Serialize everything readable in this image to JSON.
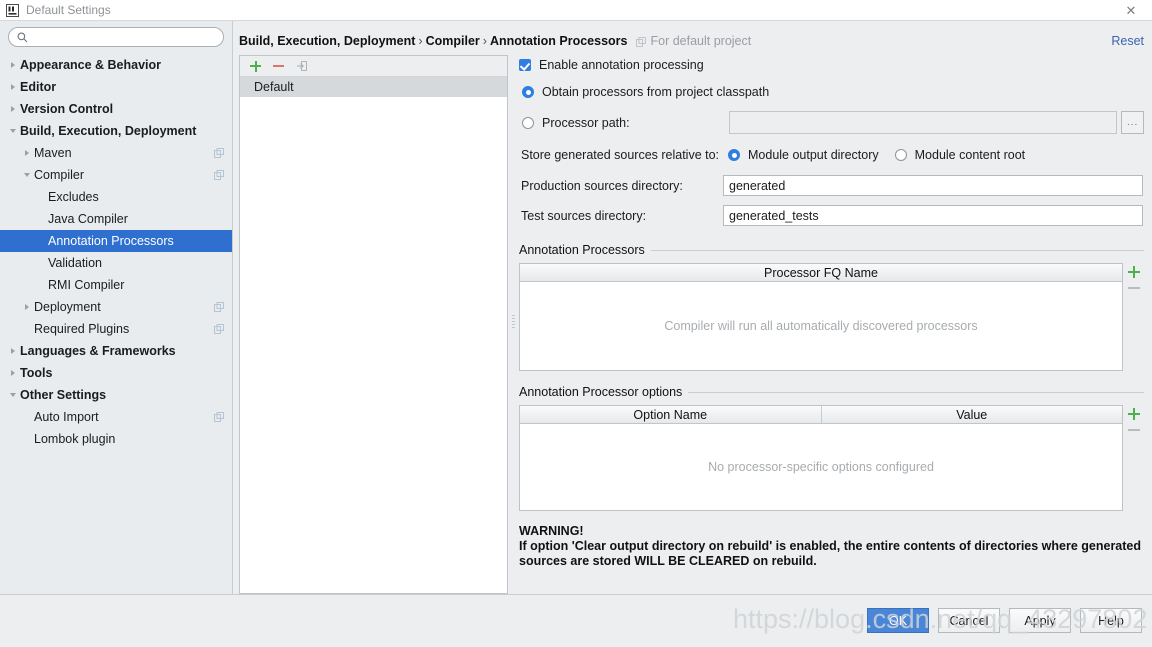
{
  "window": {
    "title": "Default Settings",
    "app_icon": "intellij-idea-icon",
    "close_label": "✕"
  },
  "sidebar": {
    "search": {
      "value": "",
      "placeholder": "",
      "icon": "search-icon"
    },
    "items": [
      {
        "label": "Appearance & Behavior",
        "indent": 0,
        "twisty": "right",
        "bold": true,
        "badge": false,
        "selected": false
      },
      {
        "label": "Editor",
        "indent": 0,
        "twisty": "right",
        "bold": true,
        "badge": false,
        "selected": false
      },
      {
        "label": "Version Control",
        "indent": 0,
        "twisty": "right",
        "bold": true,
        "badge": false,
        "selected": false
      },
      {
        "label": "Build, Execution, Deployment",
        "indent": 0,
        "twisty": "down",
        "bold": true,
        "badge": false,
        "selected": false
      },
      {
        "label": "Maven",
        "indent": 1,
        "twisty": "right",
        "bold": false,
        "badge": true,
        "selected": false
      },
      {
        "label": "Compiler",
        "indent": 1,
        "twisty": "down",
        "bold": false,
        "badge": true,
        "selected": false
      },
      {
        "label": "Excludes",
        "indent": 2,
        "twisty": "none",
        "bold": false,
        "badge": false,
        "selected": false
      },
      {
        "label": "Java Compiler",
        "indent": 2,
        "twisty": "none",
        "bold": false,
        "badge": false,
        "selected": false
      },
      {
        "label": "Annotation Processors",
        "indent": 2,
        "twisty": "none",
        "bold": false,
        "badge": false,
        "selected": true
      },
      {
        "label": "Validation",
        "indent": 2,
        "twisty": "none",
        "bold": false,
        "badge": false,
        "selected": false
      },
      {
        "label": "RMI Compiler",
        "indent": 2,
        "twisty": "none",
        "bold": false,
        "badge": false,
        "selected": false
      },
      {
        "label": "Deployment",
        "indent": 1,
        "twisty": "right",
        "bold": false,
        "badge": true,
        "selected": false
      },
      {
        "label": "Required Plugins",
        "indent": 1,
        "twisty": "none",
        "bold": false,
        "badge": true,
        "selected": false
      },
      {
        "label": "Languages & Frameworks",
        "indent": 0,
        "twisty": "right",
        "bold": true,
        "badge": false,
        "selected": false
      },
      {
        "label": "Tools",
        "indent": 0,
        "twisty": "right",
        "bold": true,
        "badge": false,
        "selected": false
      },
      {
        "label": "Other Settings",
        "indent": 0,
        "twisty": "down",
        "bold": true,
        "badge": false,
        "selected": false
      },
      {
        "label": "Auto Import",
        "indent": 1,
        "twisty": "none",
        "bold": false,
        "badge": true,
        "selected": false
      },
      {
        "label": "Lombok plugin",
        "indent": 1,
        "twisty": "none",
        "bold": false,
        "badge": false,
        "selected": false
      }
    ]
  },
  "header": {
    "crumb_1": "Build, Execution, Deployment",
    "crumb_2": "Compiler",
    "crumb_3": "Annotation Processors",
    "separator": "›",
    "scope_label": "For default project",
    "scope_icon": "module-badge-icon",
    "reset_label": "Reset"
  },
  "profiles": {
    "toolbar": [
      {
        "name": "add-profile-button",
        "icon": "plus-icon"
      },
      {
        "name": "remove-profile-button",
        "icon": "minus-icon"
      },
      {
        "name": "move-to-profile-button",
        "icon": "move-right-icon"
      }
    ],
    "items": [
      {
        "label": "Default",
        "selected": true
      }
    ]
  },
  "form": {
    "enable_annotation_processing": {
      "label": "Enable annotation processing",
      "checked": true
    },
    "obtain_from_classpath": {
      "label": "Obtain processors from project classpath",
      "checked": true
    },
    "processor_path": {
      "label": "Processor path:",
      "checked": false,
      "value": "",
      "placeholder": "",
      "browse_label": "..."
    },
    "store_relative_label": "Store generated sources relative to:",
    "store_options": [
      {
        "label": "Module output directory",
        "checked": true
      },
      {
        "label": "Module content root",
        "checked": false
      }
    ],
    "production_sources": {
      "label": "Production sources directory:",
      "value": "generated"
    },
    "test_sources": {
      "label": "Test sources directory:",
      "value": "generated_tests"
    }
  },
  "processors_table": {
    "title": "Annotation Processors",
    "columns": [
      "Processor FQ Name"
    ],
    "rows": [],
    "empty_message": "Compiler will run all automatically discovered processors",
    "add_icon": "plus-icon",
    "remove_icon": "minus-icon"
  },
  "options_table": {
    "title": "Annotation Processor options",
    "columns": [
      "Option Name",
      "Value"
    ],
    "rows": [],
    "empty_message": "No processor-specific options configured",
    "add_icon": "plus-icon",
    "remove_icon": "minus-icon"
  },
  "warning": {
    "heading": "WARNING!",
    "line_1": "If option 'Clear output directory on rebuild' is enabled, the entire contents of directories where generated",
    "line_2": "sources are stored WILL BE CLEARED on rebuild."
  },
  "footer": {
    "buttons": [
      {
        "label": "OK",
        "primary": true
      },
      {
        "label": "Cancel",
        "primary": false
      },
      {
        "label": "Apply",
        "primary": false
      },
      {
        "label": "Help",
        "primary": false
      }
    ]
  },
  "watermark": {
    "text": "https://blog.csdn.net/qq_43297802"
  },
  "colors": {
    "selection_blue": "#2f6fd0",
    "accent_blue": "#2f7ee0",
    "link_blue": "#3a62b5",
    "green": "#4caf50",
    "red": "#d9766b",
    "panel_bg": "#eceef0",
    "sidebar_bg": "#e8ecef"
  }
}
